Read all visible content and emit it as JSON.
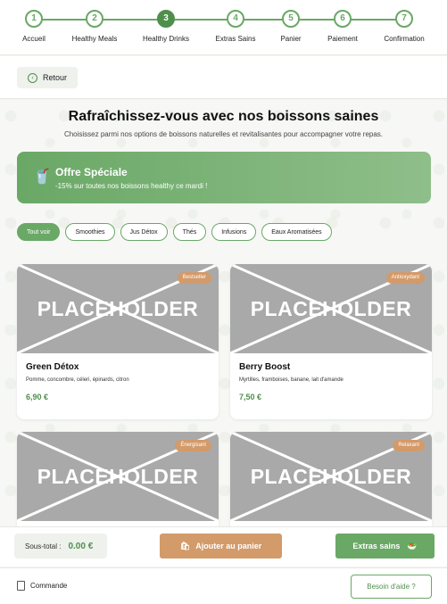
{
  "stepper": {
    "steps": [
      {
        "number": "1",
        "label": "Accueil"
      },
      {
        "number": "2",
        "label": "Healthy Meals"
      },
      {
        "number": "3",
        "label": "Healthy Drinks"
      },
      {
        "number": "4",
        "label": "Extras Sains"
      },
      {
        "number": "5",
        "label": "Panier"
      },
      {
        "number": "6",
        "label": "Paiement"
      },
      {
        "number": "7",
        "label": "Confirmation"
      }
    ],
    "active_step": 3
  },
  "back": {
    "label": "Retour"
  },
  "page": {
    "title": "Rafraîchissez-vous avec nos boissons saines",
    "subtitle": "Choisissez parmi nos options de boissons naturelles et revitalisantes pour accompagner votre repas."
  },
  "offer": {
    "title": "Offre Spéciale",
    "text": "-15% sur toutes nos boissons healthy ce mardi !",
    "icon": "drink-cup-icon"
  },
  "filters": [
    "Tout voir",
    "Smoothies",
    "Jus Détox",
    "Thés",
    "Infusions",
    "Eaux Aromatisées"
  ],
  "active_filter": "Tout voir",
  "products": [
    {
      "name": "Green Détox",
      "ingredients": "Pomme, concombre, céleri, épinards, citron",
      "price": "6,90 €",
      "badge": "Bestseller",
      "image_text": "PLACEHOLDER"
    },
    {
      "name": "Berry Boost",
      "ingredients": "Myrtilles, framboises, banane, lait d'amande",
      "price": "7,50 €",
      "badge": "Antioxydant",
      "image_text": "PLACEHOLDER"
    },
    {
      "name": "",
      "ingredients": "",
      "price": "",
      "badge": "Énergisant",
      "image_text": "PLACEHOLDER"
    },
    {
      "name": "",
      "ingredients": "",
      "price": "",
      "badge": "Relaxant",
      "image_text": "PLACEHOLDER"
    }
  ],
  "actions": {
    "subtotal_label": "Sous-total :",
    "subtotal_value": "0.00 €",
    "add_to_cart": "Ajouter au panier",
    "next": "Extras sains"
  },
  "footer": {
    "order_label": "Commande",
    "help_label": "Besoin d'aide ?"
  },
  "colors": {
    "primary": "#6aa866",
    "primary_dark": "#4f8f4c",
    "accent": "#d39a6a",
    "placeholder": "#a9a9a9"
  }
}
